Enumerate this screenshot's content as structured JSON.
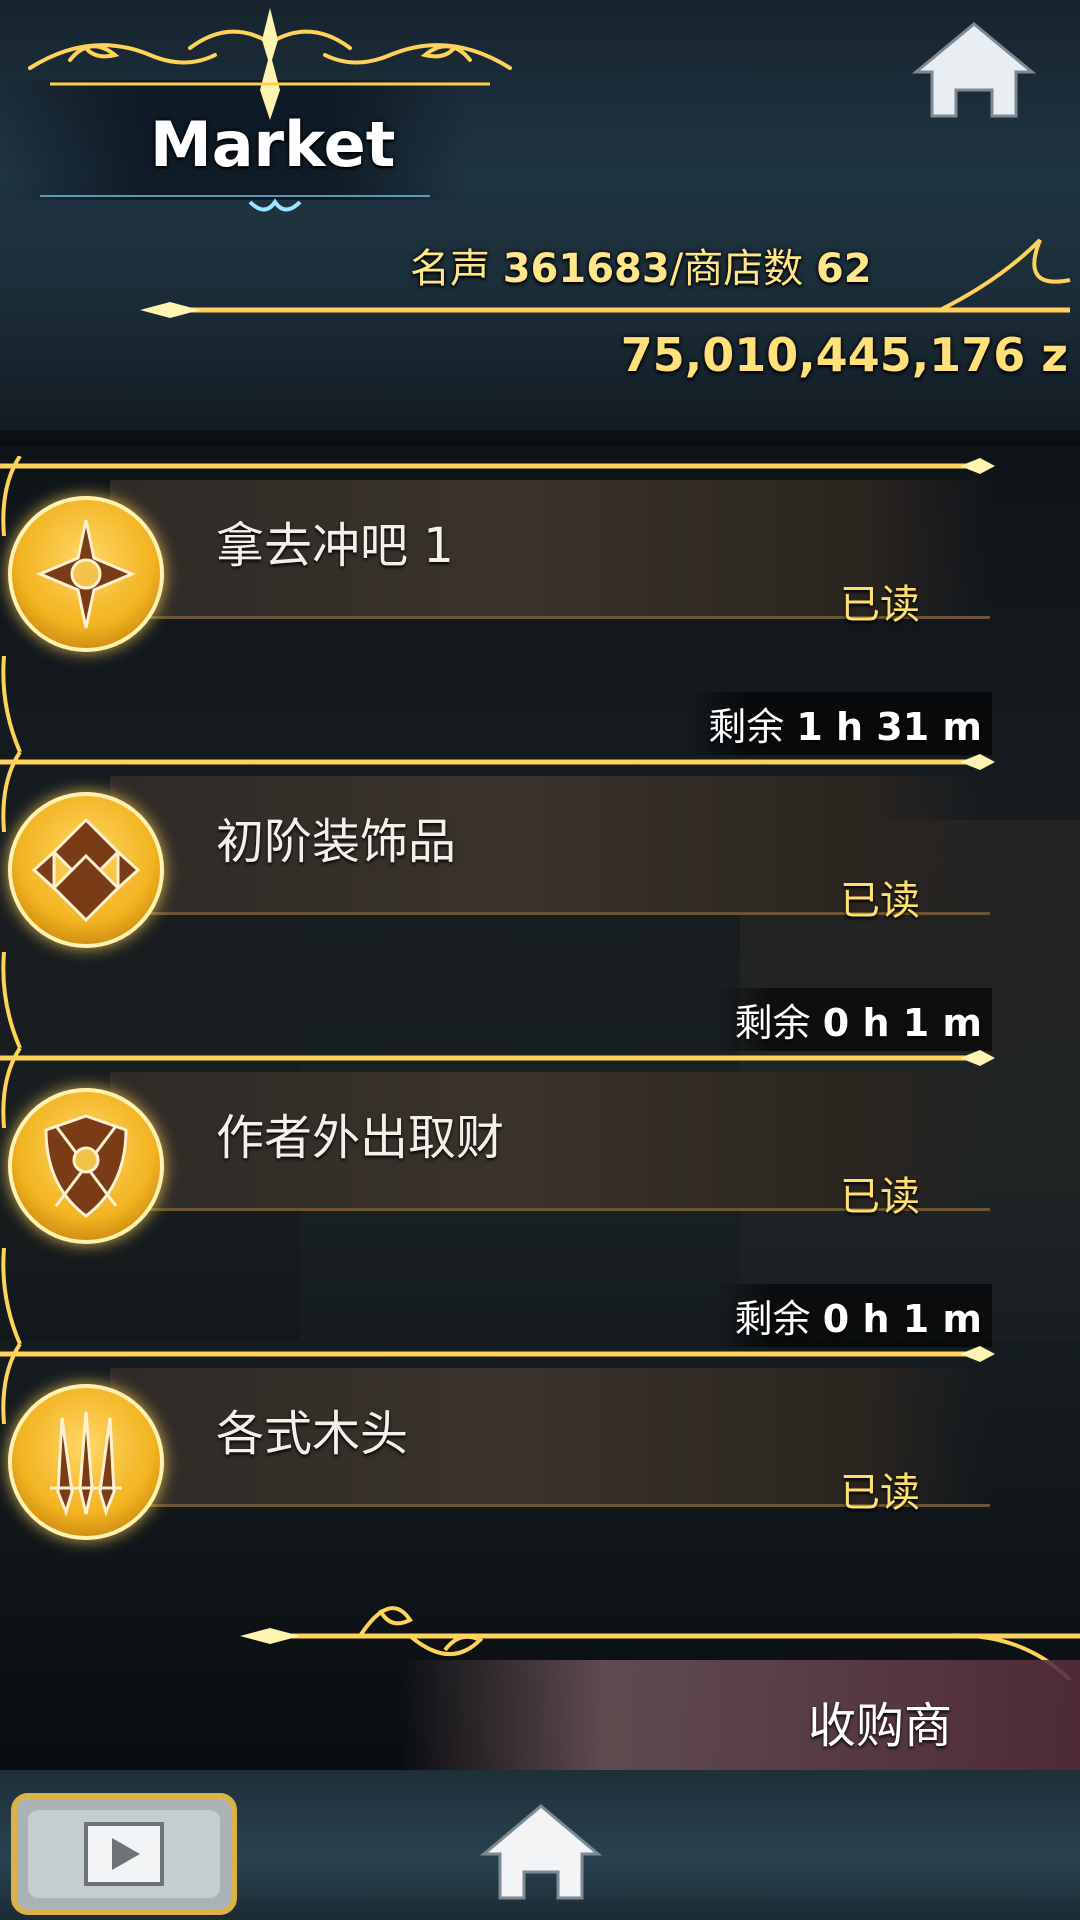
{
  "header": {
    "title": "Market",
    "fame_label": "名声",
    "fame_value": "361683",
    "shop_count_label": "/商店数",
    "shop_count_value": "62",
    "money": "75,010,445,176 z"
  },
  "orders": [
    {
      "name": "拿去冲吧 1",
      "status": "已读",
      "timer_label": "剩余",
      "timer_value": "1 h 31 m",
      "icon": "compass-cross-icon"
    },
    {
      "name": "初阶装饰品",
      "status": "已读",
      "timer_label": "剩余",
      "timer_value": "0 h 1 m",
      "icon": "diamond-ornament-icon"
    },
    {
      "name": "作者外出取财",
      "status": "已读",
      "timer_label": "剩余",
      "timer_value": "0 h 1 m",
      "icon": "forge-shield-icon"
    },
    {
      "name": "各式木头",
      "status": "已读",
      "icon": "crossed-swords-icon"
    }
  ],
  "bottom": {
    "vendor_label": "收购商"
  },
  "colors": {
    "gold": "#ffd35a",
    "text_yellow": "#ffe06f"
  }
}
